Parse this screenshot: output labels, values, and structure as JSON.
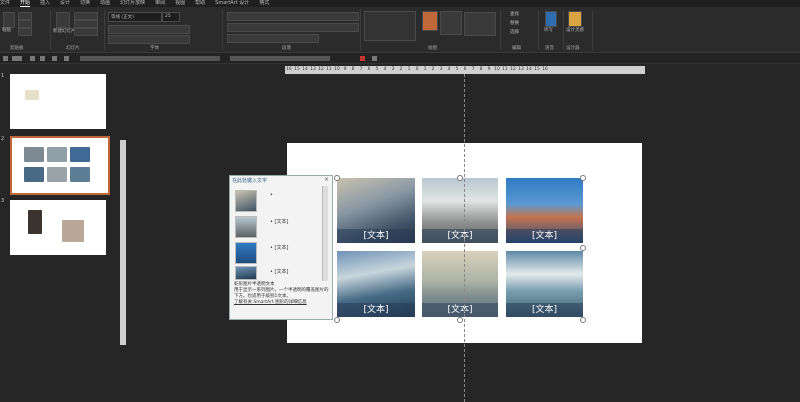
{
  "ribbon": {
    "tabs": [
      "文件",
      "开始",
      "插入",
      "设计",
      "切换",
      "动画",
      "幻灯片放映",
      "审阅",
      "视图",
      "帮助",
      "SmartArt 设计",
      "格式"
    ],
    "active_tab": "开始",
    "groups": [
      "剪贴板",
      "幻灯片",
      "字体",
      "段落",
      "绘图",
      "编辑",
      "语音",
      "设计器"
    ],
    "font_name": "等线 (正文)",
    "font_size": "25",
    "paste_label": "粘贴",
    "new_slide_label": "新建幻灯片",
    "find_label": "查找",
    "replace_label": "替换",
    "select_label": "选择",
    "dictate_label": "听写",
    "designer_label": "设计灵感"
  },
  "ruler": {
    "ticks": [
      "16",
      "15",
      "14",
      "13",
      "12",
      "11",
      "10",
      "9",
      "8",
      "7",
      "6",
      "5",
      "4",
      "3",
      "2",
      "1",
      "0",
      "1",
      "2",
      "3",
      "4",
      "5",
      "6",
      "7",
      "8",
      "9",
      "10",
      "11",
      "12",
      "13",
      "14",
      "15",
      "16"
    ]
  },
  "thumbnails": [
    {
      "number": "1"
    },
    {
      "number": "2"
    },
    {
      "number": "3"
    }
  ],
  "slide": {
    "captions": [
      "[文本]",
      "[文本]",
      "[文本]",
      "[文本]",
      "[文本]",
      "[文本]"
    ]
  },
  "text_pane": {
    "title": "在此处键入文字",
    "close": "×",
    "bullets": [
      "[文本]",
      "[文本]",
      "[文本]"
    ],
    "desc_title": "蛇形图片半透明文本",
    "desc_body": "用于显示一系列图片，一个半透明的覆盖图片的下方。也适用于级别1文本。",
    "link": "了解有关 SmartArt 图形的详细信息"
  }
}
